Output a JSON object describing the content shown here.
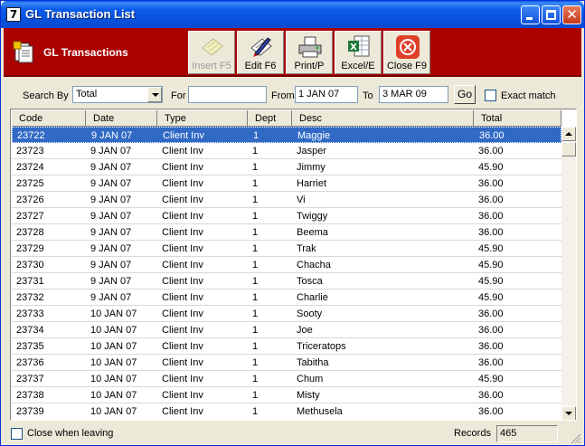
{
  "window": {
    "title": "GL Transaction List",
    "app_icon_label": "7"
  },
  "header": {
    "title": "GL Transactions",
    "buttons": [
      {
        "label": "Insert F5",
        "icon": "insert-icon",
        "enabled": false
      },
      {
        "label": "Edit F6",
        "icon": "edit-icon",
        "enabled": true
      },
      {
        "label": "Print/P",
        "icon": "printer-icon",
        "enabled": true
      },
      {
        "label": "Excel/E",
        "icon": "excel-icon",
        "enabled": true
      },
      {
        "label": "Close F9",
        "icon": "close-circle-icon",
        "enabled": true
      }
    ]
  },
  "search": {
    "search_by_label": "Search By",
    "search_by_value": "Total",
    "for_label": "For",
    "for_value": "",
    "from_label": "From",
    "from_value": "1 JAN 07",
    "to_label": "To",
    "to_value": "3 MAR 09",
    "go_label": "Go",
    "exact_match_label": "Exact match",
    "exact_match_checked": false
  },
  "table": {
    "columns": [
      "Code",
      "Date",
      "Type",
      "Dept",
      "Desc",
      "Total"
    ],
    "selected_index": 0,
    "rows": [
      [
        "23722",
        "9 JAN 07",
        "Client Inv",
        "1",
        "Maggie",
        "36.00"
      ],
      [
        "23723",
        "9 JAN 07",
        "Client Inv",
        "1",
        "Jasper",
        "36.00"
      ],
      [
        "23724",
        "9 JAN 07",
        "Client Inv",
        "1",
        "Jimmy",
        "45.90"
      ],
      [
        "23725",
        "9 JAN 07",
        "Client Inv",
        "1",
        "Harriet",
        "36.00"
      ],
      [
        "23726",
        "9 JAN 07",
        "Client Inv",
        "1",
        "Vi",
        "36.00"
      ],
      [
        "23727",
        "9 JAN 07",
        "Client Inv",
        "1",
        "Twiggy",
        "36.00"
      ],
      [
        "23728",
        "9 JAN 07",
        "Client Inv",
        "1",
        "Beema",
        "36.00"
      ],
      [
        "23729",
        "9 JAN 07",
        "Client Inv",
        "1",
        "Trak",
        "45.90"
      ],
      [
        "23730",
        "9 JAN 07",
        "Client Inv",
        "1",
        "Chacha",
        "45.90"
      ],
      [
        "23731",
        "9 JAN 07",
        "Client Inv",
        "1",
        "Tosca",
        "45.90"
      ],
      [
        "23732",
        "9 JAN 07",
        "Client Inv",
        "1",
        "Charlie",
        "45.90"
      ],
      [
        "23733",
        "10 JAN 07",
        "Client Inv",
        "1",
        "Sooty",
        "36.00"
      ],
      [
        "23734",
        "10 JAN 07",
        "Client Inv",
        "1",
        "Joe",
        "36.00"
      ],
      [
        "23735",
        "10 JAN 07",
        "Client Inv",
        "1",
        "Triceratops",
        "36.00"
      ],
      [
        "23736",
        "10 JAN 07",
        "Client Inv",
        "1",
        "Tabitha",
        "36.00"
      ],
      [
        "23737",
        "10 JAN 07",
        "Client Inv",
        "1",
        "Chum",
        "45.90"
      ],
      [
        "23738",
        "10 JAN 07",
        "Client Inv",
        "1",
        "Misty",
        "36.00"
      ],
      [
        "23739",
        "10 JAN 07",
        "Client Inv",
        "1",
        "Methusela",
        "36.00"
      ]
    ]
  },
  "footer": {
    "close_when_leaving_label": "Close when leaving",
    "close_when_leaving_checked": false,
    "records_label": "Records",
    "records_value": "465"
  },
  "colors": {
    "header_band": "#aa0000",
    "selection": "#316ac5",
    "titlebar": "#0a58e8"
  }
}
